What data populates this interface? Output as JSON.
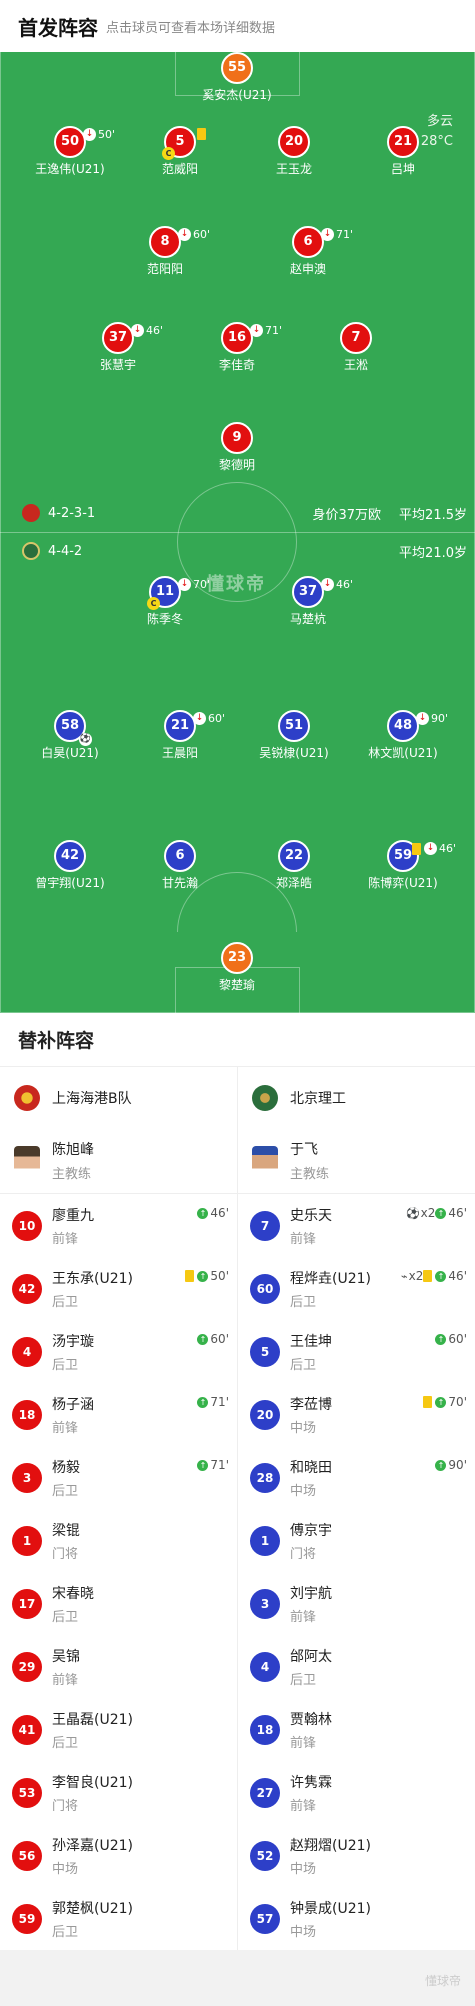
{
  "header": {
    "title": "首发阵容",
    "hint": "点击球员可查看本场详细数据"
  },
  "weather": {
    "condition": "多云",
    "temp": "28°C"
  },
  "watermark": "懂球帝",
  "home_team": {
    "formation": "4-2-3-1",
    "value": "身价37万欧",
    "avg_age": "平均21.5岁",
    "color": "#e20f0f"
  },
  "away_team": {
    "formation": "4-4-2",
    "avg_age": "平均21.0岁",
    "color": "#2d3fc8"
  },
  "home_players": [
    {
      "num": "55",
      "name": "奚安杰(U21)",
      "color": "orange"
    },
    {
      "num": "50",
      "name": "王逸伟(U21)",
      "sub": "50'",
      "color": "red"
    },
    {
      "num": "5",
      "name": "范威阳",
      "color": "red"
    },
    {
      "num": "20",
      "name": "王玉龙",
      "color": "red"
    },
    {
      "num": "21",
      "name": "吕坤",
      "color": "red"
    },
    {
      "num": "8",
      "name": "范阳阳",
      "sub": "60'",
      "color": "red"
    },
    {
      "num": "6",
      "name": "赵申澳",
      "sub": "71'",
      "color": "red"
    },
    {
      "num": "37",
      "name": "张慧宇",
      "sub": "46'",
      "color": "red"
    },
    {
      "num": "16",
      "name": "李佳奇",
      "sub": "71'",
      "color": "red"
    },
    {
      "num": "7",
      "name": "王淞",
      "color": "red"
    },
    {
      "num": "9",
      "name": "黎德明",
      "color": "red"
    }
  ],
  "away_players": [
    {
      "num": "11",
      "name": "陈季冬",
      "sub": "70'",
      "color": "blue"
    },
    {
      "num": "37",
      "name": "马楚杭",
      "sub": "46'",
      "color": "blue"
    },
    {
      "num": "58",
      "name": "白昊(U21)",
      "color": "blue"
    },
    {
      "num": "21",
      "name": "王晨阳",
      "sub": "60'",
      "color": "blue"
    },
    {
      "num": "51",
      "name": "吴锐棣(U21)",
      "color": "blue"
    },
    {
      "num": "48",
      "name": "林文凯(U21)",
      "sub": "90'",
      "color": "blue"
    },
    {
      "num": "42",
      "name": "曾宇翔(U21)",
      "color": "blue"
    },
    {
      "num": "6",
      "name": "甘先瀚",
      "color": "blue"
    },
    {
      "num": "22",
      "name": "郑泽皓",
      "color": "blue"
    },
    {
      "num": "59",
      "name": "陈博弈(U21)",
      "sub": "46'",
      "color": "blue"
    },
    {
      "num": "23",
      "name": "黎楚瑜",
      "color": "orange"
    }
  ],
  "subs": {
    "title": "替补阵容",
    "left": {
      "team": "上海海港B队",
      "coach": {
        "name": "陈旭峰",
        "role": "主教练"
      },
      "players": [
        {
          "num": "10",
          "name": "廖重九",
          "pos": "前锋",
          "ev": "46'"
        },
        {
          "num": "42",
          "name": "王东承(U21)",
          "pos": "后卫",
          "ev": "50'"
        },
        {
          "num": "4",
          "name": "汤宇璇",
          "pos": "后卫",
          "ev": "60'"
        },
        {
          "num": "18",
          "name": "杨子涵",
          "pos": "前锋",
          "ev": "71'"
        },
        {
          "num": "3",
          "name": "杨毅",
          "pos": "后卫",
          "ev": "71'"
        },
        {
          "num": "1",
          "name": "梁锟",
          "pos": "门将",
          "ev": ""
        },
        {
          "num": "17",
          "name": "宋春晓",
          "pos": "后卫",
          "ev": ""
        },
        {
          "num": "29",
          "name": "吴锦",
          "pos": "前锋",
          "ev": ""
        },
        {
          "num": "41",
          "name": "王晶磊(U21)",
          "pos": "后卫",
          "ev": ""
        },
        {
          "num": "53",
          "name": "李智良(U21)",
          "pos": "门将",
          "ev": ""
        },
        {
          "num": "56",
          "name": "孙泽嘉(U21)",
          "pos": "中场",
          "ev": ""
        },
        {
          "num": "59",
          "name": "郭楚枫(U21)",
          "pos": "后卫",
          "ev": ""
        }
      ]
    },
    "right": {
      "team": "北京理工",
      "coach": {
        "name": "于飞",
        "role": "主教练"
      },
      "players": [
        {
          "num": "7",
          "name": "史乐天",
          "pos": "前锋",
          "goals": "x2",
          "ev": "46'"
        },
        {
          "num": "60",
          "name": "程烨垚(U21)",
          "pos": "后卫",
          "assists": "x2",
          "ev": "46'"
        },
        {
          "num": "5",
          "name": "王佳坤",
          "pos": "后卫",
          "ev": "60'"
        },
        {
          "num": "20",
          "name": "李莅博",
          "pos": "中场",
          "ev": "70'"
        },
        {
          "num": "28",
          "name": "和晓田",
          "pos": "中场",
          "ev": "90'"
        },
        {
          "num": "1",
          "name": "傅京宇",
          "pos": "门将",
          "ev": ""
        },
        {
          "num": "3",
          "name": "刘宇航",
          "pos": "前锋",
          "ev": ""
        },
        {
          "num": "4",
          "name": "邰阿太",
          "pos": "后卫",
          "ev": ""
        },
        {
          "num": "18",
          "name": "贾翰林",
          "pos": "前锋",
          "ev": ""
        },
        {
          "num": "27",
          "name": "许隽霖",
          "pos": "前锋",
          "ev": ""
        },
        {
          "num": "52",
          "name": "赵翔熠(U21)",
          "pos": "中场",
          "ev": ""
        },
        {
          "num": "57",
          "name": "钟景成(U21)",
          "pos": "中场",
          "ev": ""
        }
      ]
    }
  }
}
